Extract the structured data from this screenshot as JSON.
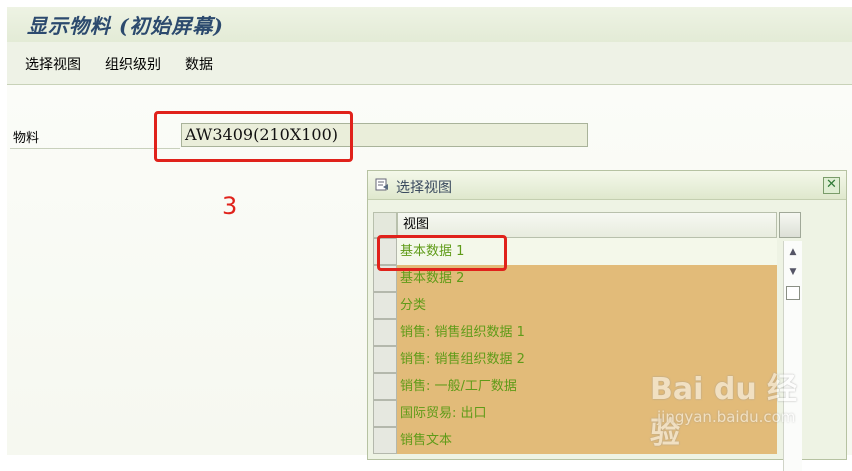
{
  "window": {
    "title": "显示物料 (初始屏幕)"
  },
  "menu": {
    "items": [
      "选择视图",
      "组织级别",
      "数据"
    ]
  },
  "form": {
    "material_label": "物料",
    "material_value": "AW3409(210X100)"
  },
  "annotation": {
    "step_number": "3"
  },
  "dialog": {
    "title": "选择视图",
    "close_symbol": "✕",
    "column_header": "视图",
    "rows": [
      "基本数据 1",
      "基本数据 2",
      "分类",
      "销售: 销售组织数据 1",
      "销售: 销售组织数据 2",
      "销售: 一般/工厂数据",
      "国际贸易: 出口",
      "销售文本"
    ],
    "scroll_up": "▲",
    "scroll_down": "▼"
  },
  "watermark": {
    "logo_text": "Bai du 经验",
    "url": "jingyan.baidu.com"
  },
  "colors": {
    "accent_red": "#e0221b",
    "row_text_green": "#5f9b18",
    "row_bg_orange": "#e2bb79",
    "title_blue": "#2c4a6e"
  },
  "icons": [
    "dialog-title-icon",
    "close-icon",
    "scroll-up-icon",
    "scroll-down-icon"
  ]
}
